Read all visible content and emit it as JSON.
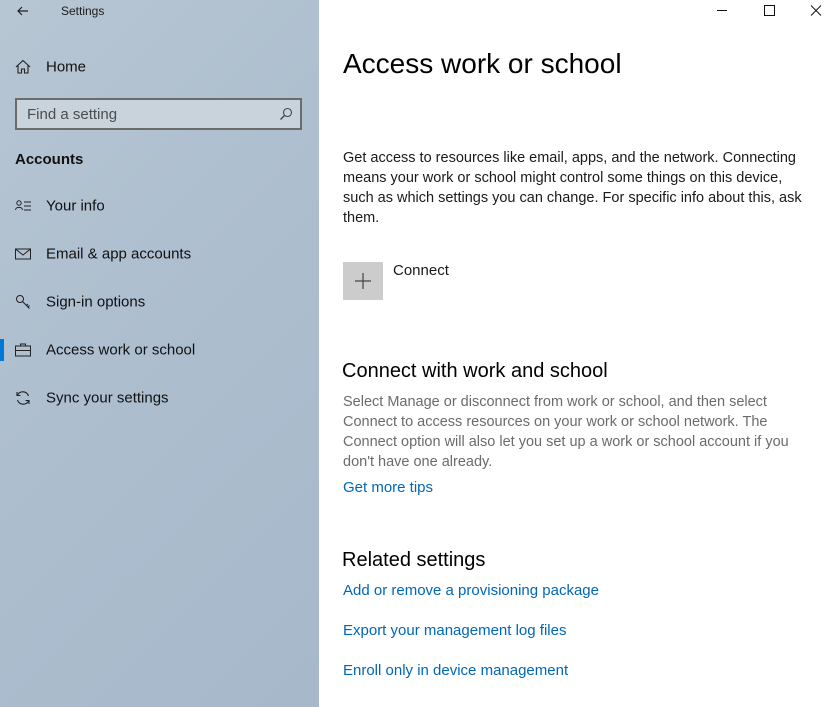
{
  "window": {
    "title": "Settings",
    "controls": [
      "minimize",
      "maximize",
      "close"
    ]
  },
  "sidebar": {
    "home_label": "Home",
    "search_placeholder": "Find a setting",
    "section_heading": "Accounts",
    "items": [
      {
        "label": "Your info",
        "icon": "person-card-icon"
      },
      {
        "label": "Email & app accounts",
        "icon": "envelope-icon"
      },
      {
        "label": "Sign-in options",
        "icon": "key-icon"
      },
      {
        "label": "Access work or school",
        "icon": "briefcase-icon",
        "selected": true
      },
      {
        "label": "Sync your settings",
        "icon": "sync-icon"
      }
    ],
    "accent_color": "#0078d7"
  },
  "main": {
    "title": "Access work or school",
    "intro": "Get access to resources like email, apps, and the network. Connecting means your work or school might control some things on this device, such as which settings you can change. For specific info about this, ask them.",
    "connect_label": "Connect",
    "connect_section": {
      "heading": "Connect with work and school",
      "description": "Select Manage or disconnect from work or school, and then select Connect to access resources on your work or school network. The Connect option will also let you set up a work or school account if you don't have one already.",
      "tips_link": "Get more tips"
    },
    "related": {
      "heading": "Related settings",
      "links": [
        "Add or remove a provisioning package",
        "Export your management log files",
        "Enroll only in device management"
      ]
    },
    "link_color": "#0067b8"
  }
}
